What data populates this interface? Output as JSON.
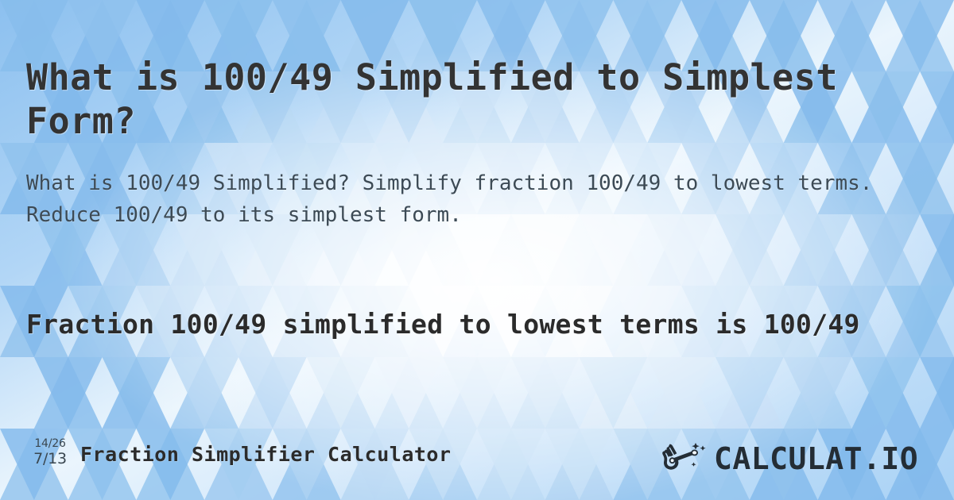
{
  "page": {
    "title": "What is 100/49 Simplified to Simplest Form?",
    "subtitle": "What is 100/49 Simplified? Simplify fraction 100/49 to lowest terms. Reduce 100/49 to its simplest form.",
    "result_statement": "Fraction 100/49 simplified to lowest terms is 100/49"
  },
  "fraction": {
    "original": "100/49",
    "simplified": "100/49",
    "numerator": 100,
    "denominator": 49
  },
  "footer": {
    "badge": {
      "numerator_label": "14/26",
      "denominator_label": "7/13"
    },
    "calculator_name": "Fraction Simplifier Calculator",
    "brand": {
      "wordmark": "CALCULAT.IO",
      "icon_name": "magic-wand-hand-icon"
    }
  },
  "theme": {
    "background_top_left": "#8cc0ef",
    "background_center": "#f4fafe",
    "background_bottom_left": "#c8e0f7",
    "background_right": "#a8d1f5",
    "title_color": "#333333",
    "subtitle_color": "#3c4a55",
    "result_color": "#2b2b2b",
    "logo_color": "#242d35"
  }
}
